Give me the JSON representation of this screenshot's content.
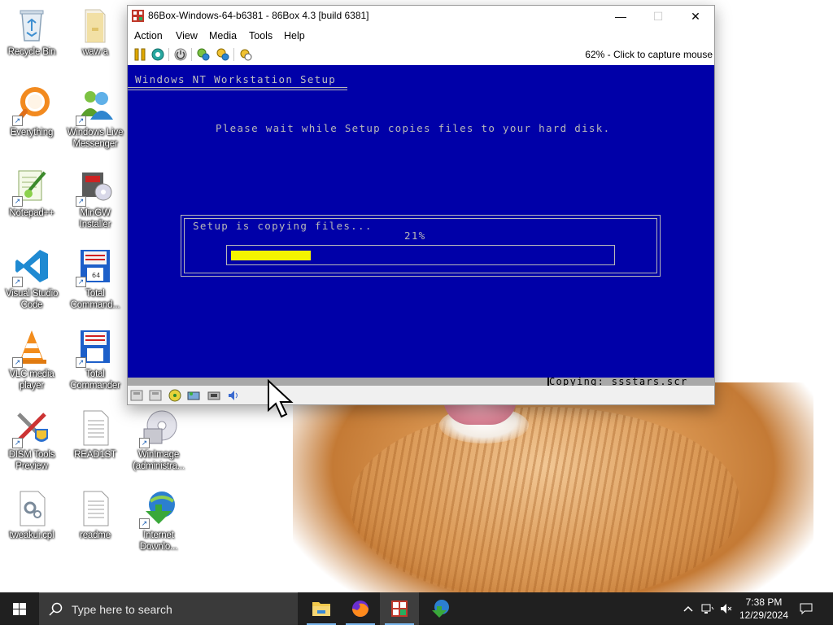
{
  "desktop": {
    "icons": [
      {
        "label": "Recycle Bin"
      },
      {
        "label": "waw a"
      },
      {
        "label": "Everything"
      },
      {
        "label": "Windows Live Messenger"
      },
      {
        "label": "Notepad++"
      },
      {
        "label": "MinGW Installer"
      },
      {
        "label": "Visual Studio Code"
      },
      {
        "label": "Total Command..."
      },
      {
        "label": "VLC media player"
      },
      {
        "label": "Total Commander"
      },
      {
        "label": "DISM Tools Preview"
      },
      {
        "label": "READ1ST"
      },
      {
        "label": "WinImage (administra..."
      },
      {
        "label": "tweakui.cpl"
      },
      {
        "label": "readme"
      },
      {
        "label": "Internet Downlo..."
      }
    ]
  },
  "window": {
    "title": "86Box-Windows-64-b6381 - 86Box 4.3 [build 6381]",
    "minimize": "—",
    "maximize": "☐",
    "close": "✕",
    "menu": [
      "Action",
      "View",
      "Media",
      "Tools",
      "Help"
    ],
    "capture_text": "62% - Click to capture mouse"
  },
  "guest": {
    "setup_title": "Windows NT Workstation Setup",
    "wait_message": "Please wait while Setup copies files to your hard disk.",
    "copy_label": "Setup is copying files...",
    "percent_text": "21%",
    "progress": 0.21,
    "status": "Copying: ssstars.scr",
    "colors": {
      "background": "#0000a8",
      "bar": "#f4f400",
      "status_bar": "#a8a8a8"
    }
  },
  "taskbar": {
    "search_placeholder": "Type here to search",
    "time": "7:38 PM",
    "date": "12/29/2024"
  }
}
